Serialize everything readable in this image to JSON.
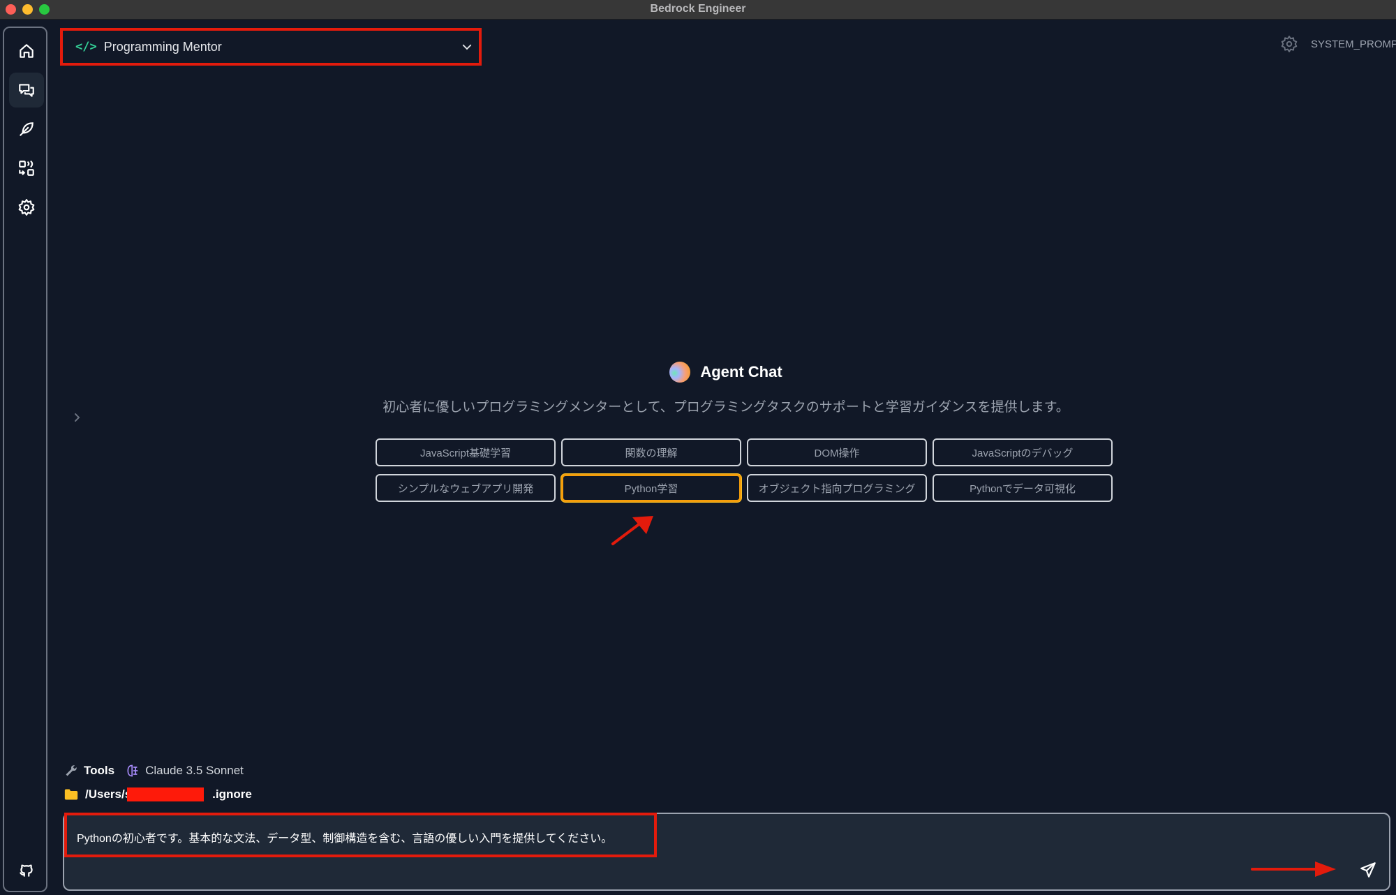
{
  "window": {
    "title": "Bedrock Engineer"
  },
  "sidebar": {
    "items": [
      {
        "name": "home",
        "icon": "home-icon",
        "active": false
      },
      {
        "name": "chat",
        "icon": "chat-bubbles-icon",
        "active": true
      },
      {
        "name": "writer",
        "icon": "feather-icon",
        "active": false
      },
      {
        "name": "step-functions",
        "icon": "flow-icon",
        "active": false
      },
      {
        "name": "settings",
        "icon": "gear-icon",
        "active": false
      }
    ],
    "footer_icon": "github-icon"
  },
  "header": {
    "agent_selector": {
      "code_icon": "</>",
      "selected": "Programming Mentor"
    },
    "system_prompt_label": "SYSTEM_PROMPT"
  },
  "main": {
    "title": "Agent Chat",
    "description": "初心者に優しいプログラミングメンターとして、プログラミングタスクのサポートと学習ガイダンスを提供します。",
    "examples": [
      {
        "label": "JavaScript基礎学習",
        "selected": false
      },
      {
        "label": "関数の理解",
        "selected": false
      },
      {
        "label": "DOM操作",
        "selected": false
      },
      {
        "label": "JavaScriptのデバッグ",
        "selected": false
      },
      {
        "label": "シンプルなウェブアプリ開発",
        "selected": false
      },
      {
        "label": "Python学習",
        "selected": true
      },
      {
        "label": "オブジェクト指向プログラミング",
        "selected": false
      },
      {
        "label": "Pythonでデータ可視化",
        "selected": false
      }
    ]
  },
  "footer": {
    "tools_label": "Tools",
    "model_label": "Claude 3.5 Sonnet",
    "directory_prefix": "/Users/s",
    "directory_suffix": ".ignore",
    "input_value": "Pythonの初心者です。基本的な文法、データ型、制御構造を含む、言語の優しい入門を提供してください。"
  },
  "colors": {
    "background": "#111827",
    "accent_green": "#34d399",
    "selected_border": "#f59e0b",
    "annotation_red": "#e31b0c"
  }
}
